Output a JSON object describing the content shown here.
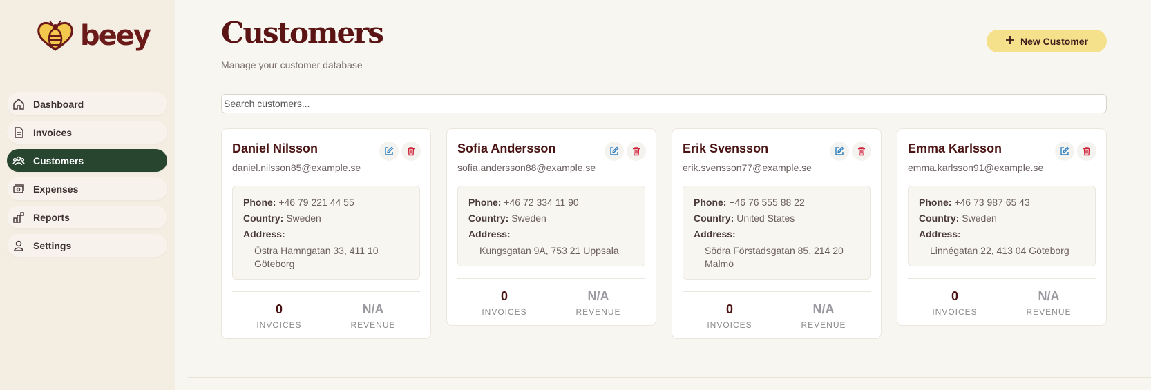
{
  "app": {
    "logo_text": "beey"
  },
  "sidebar": {
    "items": [
      {
        "label": "Dashboard",
        "icon": "home-icon",
        "active": false
      },
      {
        "label": "Invoices",
        "icon": "document-icon",
        "active": false
      },
      {
        "label": "Customers",
        "icon": "users-icon",
        "active": true
      },
      {
        "label": "Expenses",
        "icon": "wallet-icon",
        "active": false
      },
      {
        "label": "Reports",
        "icon": "chart-icon",
        "active": false
      },
      {
        "label": "Settings",
        "icon": "user-icon",
        "active": false
      }
    ]
  },
  "header": {
    "title": "Customers",
    "subtitle": "Manage your customer database",
    "new_button_label": "New Customer"
  },
  "search": {
    "placeholder": "Search customers..."
  },
  "labels": {
    "phone": "Phone:",
    "country": "Country:",
    "address": "Address:",
    "invoices": "INVOICES",
    "revenue": "REVENUE"
  },
  "customers": [
    {
      "name": "Daniel Nilsson",
      "email": "daniel.nilsson85@example.se",
      "phone": "+46 79 221 44 55",
      "country": "Sweden",
      "address": "Östra Hamngatan 33, 411 10 Göteborg",
      "invoices": "0",
      "revenue": "N/A"
    },
    {
      "name": "Sofia Andersson",
      "email": "sofia.andersson88@example.se",
      "phone": "+46 72 334 11 90",
      "country": "Sweden",
      "address": "Kungsgatan 9A, 753 21 Uppsala",
      "invoices": "0",
      "revenue": "N/A"
    },
    {
      "name": "Erik Svensson",
      "email": "erik.svensson77@example.se",
      "phone": "+46 76 555 88 22",
      "country": "United States",
      "address": "Södra Förstadsgatan 85, 214 20 Malmö",
      "invoices": "0",
      "revenue": "N/A"
    },
    {
      "name": "Emma Karlsson",
      "email": "emma.karlsson91@example.se",
      "phone": "+46 73 987 65 43",
      "country": "Sweden",
      "address": "Linnégatan 22, 413 04 Göteborg",
      "invoices": "0",
      "revenue": "N/A"
    }
  ],
  "colors": {
    "accent_dark": "#27452f",
    "title": "#5a1414",
    "button": "#f5e08c",
    "edit": "#2f7fc1",
    "delete": "#d0243a"
  }
}
